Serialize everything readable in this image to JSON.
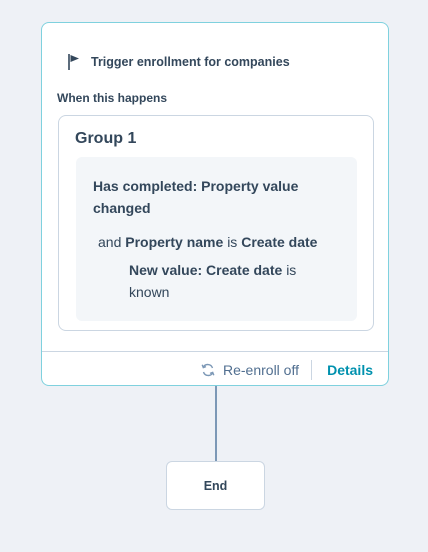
{
  "trigger": {
    "icon": "flag-icon",
    "title": "Trigger enrollment for companies",
    "when_label": "When this happens"
  },
  "group": {
    "title": "Group 1",
    "filter": {
      "main": "Has completed: Property value changed",
      "and_prefix": "and",
      "property_label": "Property name",
      "is_word": "is",
      "property_value": "Create date",
      "new_value_label": "New value: Create date",
      "new_value_suffix": "is known"
    }
  },
  "footer": {
    "reenroll_icon": "refresh-icon",
    "reenroll_label": "Re-enroll off",
    "details_label": "Details"
  },
  "end_node": {
    "label": "End"
  },
  "colors": {
    "canvas": "#eef1f6",
    "card_border": "#7fd1de",
    "accent_link": "#0091ae",
    "connector": "#7c98b6"
  }
}
